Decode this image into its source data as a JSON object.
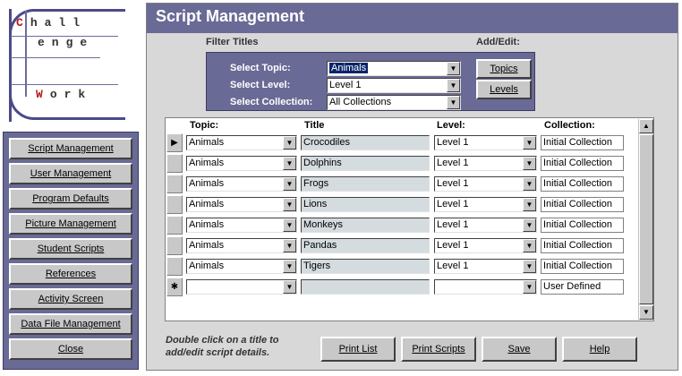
{
  "logo": {
    "line1_cap": "C",
    "line1_rest": "hall",
    "line2": "enge",
    "line3_cap": "W",
    "line3_rest": "ork"
  },
  "sidebar": {
    "items": [
      {
        "label": "Script Management"
      },
      {
        "label": "User Management"
      },
      {
        "label": "Program Defaults"
      },
      {
        "label": "Picture Management"
      },
      {
        "label": "Student Scripts"
      },
      {
        "label": "References"
      },
      {
        "label": "Activity Screen"
      },
      {
        "label": "Data File Management"
      },
      {
        "label": "Close"
      }
    ]
  },
  "header": {
    "title": "Script Management"
  },
  "filter": {
    "section_label": "Filter Titles",
    "topic_label": "Select Topic:",
    "topic_value": "Animals",
    "level_label": "Select Level:",
    "level_value": "Level 1",
    "collection_label": "Select Collection:",
    "collection_value": "All Collections"
  },
  "add_edit": {
    "section_label": "Add/Edit:",
    "topics_label": "Topics",
    "levels_label": "Levels"
  },
  "grid": {
    "headers": {
      "topic": "Topic:",
      "title": "Title",
      "level": "Level:",
      "collection": "Collection:"
    },
    "rows": [
      {
        "topic": "Animals",
        "title": "Crocodiles",
        "level": "Level 1",
        "collection": "Initial Collection",
        "marker": "▶"
      },
      {
        "topic": "Animals",
        "title": "Dolphins",
        "level": "Level 1",
        "collection": "Initial Collection",
        "marker": ""
      },
      {
        "topic": "Animals",
        "title": "Frogs",
        "level": "Level 1",
        "collection": "Initial Collection",
        "marker": ""
      },
      {
        "topic": "Animals",
        "title": "Lions",
        "level": "Level 1",
        "collection": "Initial Collection",
        "marker": ""
      },
      {
        "topic": "Animals",
        "title": "Monkeys",
        "level": "Level 1",
        "collection": "Initial Collection",
        "marker": ""
      },
      {
        "topic": "Animals",
        "title": "Pandas",
        "level": "Level 1",
        "collection": "Initial Collection",
        "marker": ""
      },
      {
        "topic": "Animals",
        "title": "Tigers",
        "level": "Level 1",
        "collection": "Initial Collection",
        "marker": ""
      },
      {
        "topic": "",
        "title": "",
        "level": "",
        "collection": "User Defined",
        "marker": "✱"
      }
    ]
  },
  "footer": {
    "hint": "Double click on a title to add/edit script details.",
    "print_list": "Print List",
    "print_scripts": "Print Scripts",
    "save": "Save",
    "help": "Help"
  }
}
